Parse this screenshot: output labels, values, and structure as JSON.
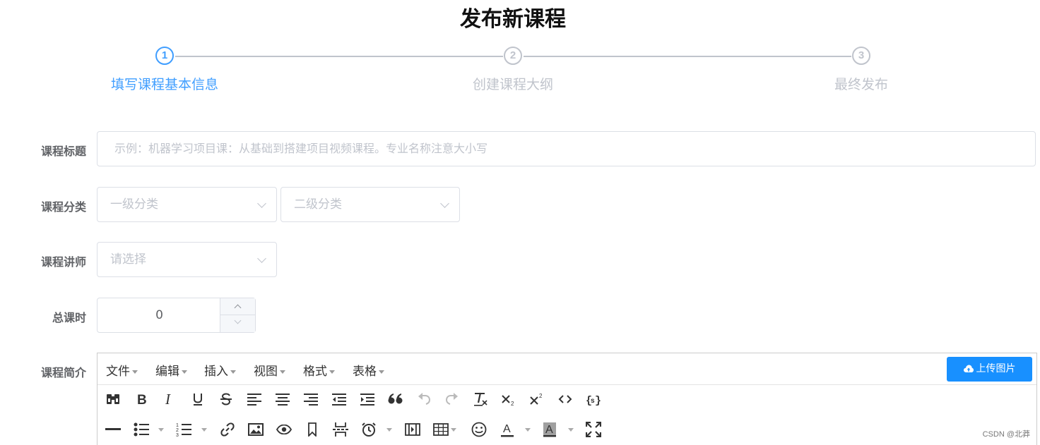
{
  "page": {
    "title": "发布新课程"
  },
  "steps": [
    {
      "number": "1",
      "label": "填写课程基本信息",
      "state": "active"
    },
    {
      "number": "2",
      "label": "创建课程大纲",
      "state": "pending"
    },
    {
      "number": "3",
      "label": "最终发布",
      "state": "pending"
    }
  ],
  "form": {
    "title": {
      "label": "课程标题",
      "placeholder": "示例：机器学习项目课：从基础到搭建项目视频课程。专业名称注意大小写"
    },
    "category": {
      "label": "课程分类",
      "level1_placeholder": "一级分类",
      "level2_placeholder": "二级分类"
    },
    "teacher": {
      "label": "课程讲师",
      "placeholder": "请选择"
    },
    "hours": {
      "label": "总课时",
      "value": "0"
    },
    "description": {
      "label": "课程简介"
    }
  },
  "editor": {
    "menus": [
      "文件",
      "编辑",
      "插入",
      "视图",
      "格式",
      "表格"
    ],
    "upload_label": "上传图片",
    "toolbar_row1": [
      "find-replace-icon",
      "bold-icon",
      "italic-icon",
      "underline-icon",
      "strikethrough-icon",
      "align-left-icon",
      "align-center-icon",
      "align-right-icon",
      "outdent-icon",
      "indent-icon",
      "blockquote-icon",
      "undo-icon",
      "redo-icon",
      "clear-format-icon",
      "subscript-icon",
      "superscript-icon",
      "code-icon",
      "code-sample-icon"
    ],
    "toolbar_row2": [
      "horizontal-rule-icon",
      "bullet-list-icon",
      "numbered-list-icon",
      "link-icon",
      "image-icon",
      "preview-icon",
      "bookmark-icon",
      "page-break-icon",
      "datetime-icon",
      "media-icon",
      "table-icon",
      "emoticons-icon",
      "text-color-icon",
      "background-color-icon",
      "fullscreen-icon"
    ]
  },
  "watermark": "CSDN @北莽",
  "colors": {
    "active": "#409eff",
    "inactive": "#c0c4cc",
    "upload_button": "#1890ff"
  }
}
